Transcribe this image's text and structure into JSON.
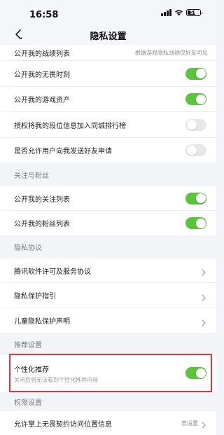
{
  "status_bar": {
    "time": "16:58",
    "battery_level": "56"
  },
  "nav": {
    "title": "隐私设置"
  },
  "colors": {
    "toggle_on": "#5bc43f",
    "toggle_off": "#e8e8ea",
    "highlight": "#e8333a"
  },
  "rows": {
    "battle_list": {
      "label": "公开我的战绩列表",
      "hint": "根据游戏隐私战绩仅好友可见"
    },
    "fearless_moments": {
      "label": "公开我的无畏时刻",
      "toggle": true
    },
    "game_assets": {
      "label": "公开我的游戏资产",
      "toggle": true
    },
    "rank_city": {
      "label": "授权将我的段位信息加入同城排行榜",
      "toggle": false
    },
    "friend_requests": {
      "label": "是否允许用户向我发送好友申请",
      "toggle": false
    }
  },
  "sections": {
    "follow_fans": {
      "header": "关注与粉丝",
      "follow_list": {
        "label": "公开我的关注列表",
        "toggle": true
      },
      "fans_list": {
        "label": "公开我的粉丝列表",
        "toggle": true
      }
    },
    "privacy_agreement": {
      "header": "隐私协议",
      "items": [
        {
          "label": "腾讯软件许可及服务协议"
        },
        {
          "label": "隐私保护指引"
        },
        {
          "label": "儿童隐私保护声明"
        }
      ]
    },
    "recommend": {
      "header": "推荐设置",
      "personalized": {
        "label": "个性化推荐",
        "sub": "关闭后将无法看到个性化推荐内容",
        "toggle": true
      }
    },
    "permissions": {
      "header": "权限设置",
      "location": {
        "label": "允许掌上无畏契约访问位置信息",
        "action": "去设置"
      }
    }
  }
}
